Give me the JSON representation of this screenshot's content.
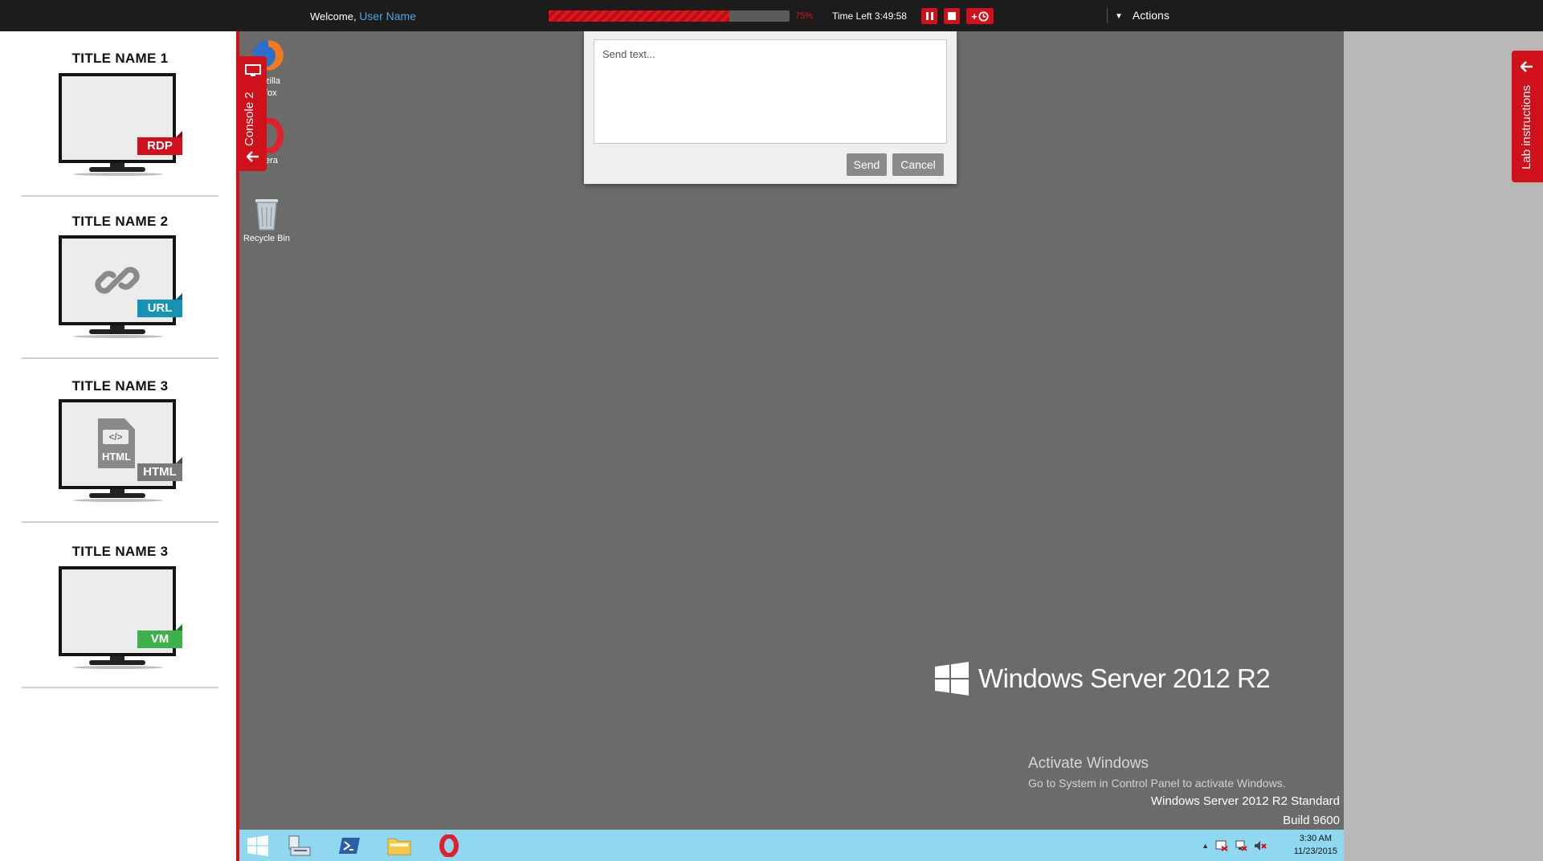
{
  "topbar": {
    "welcome_prefix": "Welcome,",
    "user_name": "User Name",
    "progress_percent": 75,
    "progress_label": "75%",
    "time_left": "Time Left 3:49:58",
    "extend_label": "+",
    "actions_label": "Actions"
  },
  "resources": [
    {
      "title": "TITLE NAME 1",
      "badge": "RDP",
      "badge_color": "#d0101a"
    },
    {
      "title": "TITLE NAME 2",
      "badge": "URL",
      "badge_color": "#1593b5"
    },
    {
      "title": "TITLE NAME 3",
      "badge": "HTML",
      "badge_color": "#7a7a7a",
      "inner_label": "HTML"
    },
    {
      "title": "TITLE NAME 3",
      "badge": "VM",
      "badge_color": "#3db14a"
    }
  ],
  "console_tab": {
    "label": "Console 2"
  },
  "lab_tab": {
    "label": "Lab instructions"
  },
  "desktop": {
    "icons": [
      {
        "label_line1": "zilla",
        "label_line2": "fox"
      },
      {
        "label_line1": "era"
      },
      {
        "label_line1": "Recycle Bin"
      }
    ],
    "logo_text": "Windows Server 2012 R2",
    "activate_title": "Activate Windows",
    "activate_sub": "Go to System in Control Panel to activate Windows.",
    "edition": "Windows Server 2012 R2 Standard",
    "build": "Build 9600"
  },
  "dialog": {
    "placeholder": "Send text...",
    "send_label": "Send",
    "cancel_label": "Cancel"
  },
  "taskbar": {
    "time": "3:30 AM",
    "date": "11/23/2015"
  },
  "colors": {
    "accent": "#d0101a",
    "topbar": "#1c1c1c",
    "desktop": "#6b6c6a",
    "taskbar": "#8fd8f0"
  }
}
